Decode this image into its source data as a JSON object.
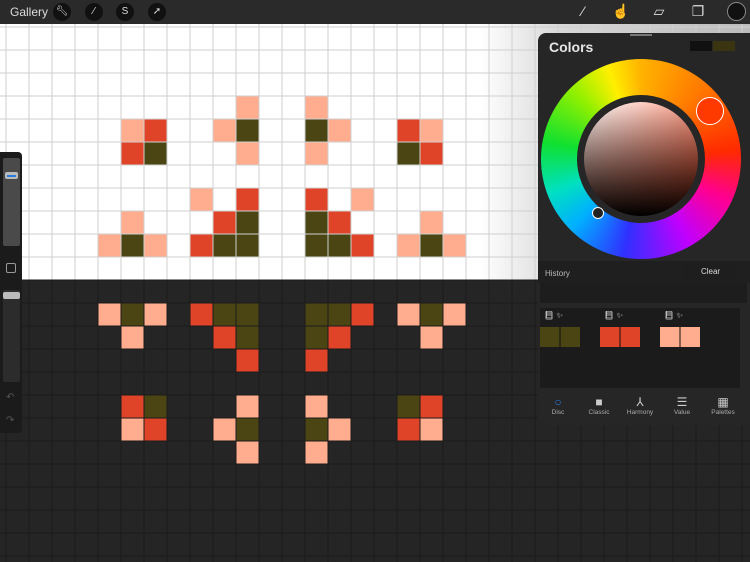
{
  "topbar": {
    "gallery": "Gallery",
    "left_icons": [
      "wrench-icon",
      "magic-wand-icon",
      "selection-icon",
      "move-arrow-icon"
    ],
    "right_icons": [
      "brush-icon",
      "smudge-icon",
      "eraser-icon",
      "layers-icon"
    ],
    "current_color": "#111111"
  },
  "colors_panel": {
    "title": "Colors",
    "current": "#111111",
    "previous": "#3a3410",
    "history_label": "History",
    "clear_label": "Clear",
    "palette": [
      "#4a4512",
      "#e04428",
      "#ffad8e"
    ],
    "tabs": [
      {
        "label": "Disc",
        "icon": "○"
      },
      {
        "label": "Classic",
        "icon": "■"
      },
      {
        "label": "Harmony",
        "icon": "⅄"
      },
      {
        "label": "Value",
        "icon": "☰"
      },
      {
        "label": "Palettes",
        "icon": "▦"
      }
    ]
  },
  "colors": {
    "P": "#ffad8e",
    "R": "#e04428",
    "O": "#4a4512"
  },
  "pattern": [
    "..........",
    "..........",
    "..........",
    "..........",
    "..........P..P",
    ".....PR..PO..OP..RP",
    ".....RO...P..P...OR",
    "",
    "........P.R..R.P",
    ".....P...RO..OR...P",
    "....POP.ROO..OOR.POP",
    "",
    "",
    "....POP.ROO..OOR.POP",
    ".....P...RO..OR...P",
    "..........R..R",
    "",
    ".....RO...P..P...OR",
    ".....PR..PO..OP..RP",
    "..........P..P"
  ]
}
